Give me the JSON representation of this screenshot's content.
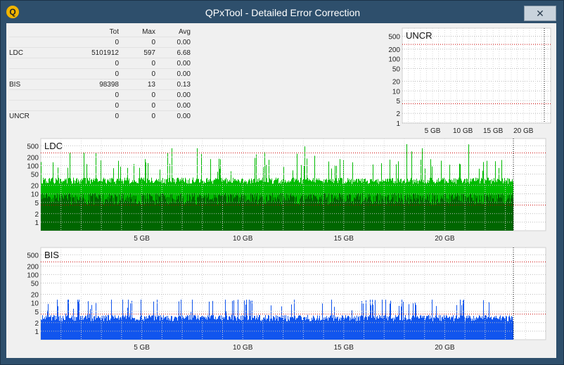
{
  "window": {
    "title": "QPxTool - Detailed Error Correction",
    "icon_letter": "Q",
    "close_glyph": "✕"
  },
  "stats": {
    "headers": [
      "",
      "Tot",
      "Max",
      "Avg"
    ],
    "rows": [
      {
        "label": "",
        "tot": "0",
        "max": "0",
        "avg": "0.00"
      },
      {
        "label": "LDC",
        "tot": "5101912",
        "max": "597",
        "avg": "6.68"
      },
      {
        "label": "",
        "tot": "0",
        "max": "0",
        "avg": "0.00"
      },
      {
        "label": "",
        "tot": "0",
        "max": "0",
        "avg": "0.00"
      },
      {
        "label": "BIS",
        "tot": "98398",
        "max": "13",
        "avg": "0.13"
      },
      {
        "label": "",
        "tot": "0",
        "max": "0",
        "avg": "0.00"
      },
      {
        "label": "",
        "tot": "0",
        "max": "0",
        "avg": "0.00"
      },
      {
        "label": "UNCR",
        "tot": "0",
        "max": "0",
        "avg": "0.00"
      }
    ]
  },
  "colors": {
    "ldc_light": "#00bb00",
    "ldc_dark": "#006600",
    "bis_light": "#1155ee",
    "bis_dark": "#001a66",
    "threshold": "#cc0000",
    "grid": "#bbbbbb"
  },
  "chart_data": [
    {
      "type": "area",
      "title": "UNCR",
      "y_ticks": [
        1,
        2,
        5,
        10,
        20,
        50,
        100,
        200,
        500
      ],
      "x_ticks": [
        "5 GB",
        "10 GB",
        "15 GB",
        "20 GB"
      ],
      "x_tick_values": [
        5,
        10,
        15,
        20
      ],
      "xlim": [
        0,
        24.5
      ],
      "ylim": [
        1,
        900
      ],
      "log_scale": true,
      "threshold_lines": [
        4,
        280
      ],
      "series": [
        {
          "values_max": 0
        }
      ]
    },
    {
      "type": "area",
      "title": "LDC",
      "y_ticks": [
        1,
        2,
        5,
        10,
        20,
        50,
        100,
        200,
        500
      ],
      "x_ticks": [
        "5 GB",
        "10 GB",
        "15 GB",
        "20 GB"
      ],
      "x_tick_values": [
        5,
        10,
        15,
        20
      ],
      "xlim": [
        0,
        25
      ],
      "ylim": [
        0.5,
        900
      ],
      "log_scale": true,
      "threshold_lines": [
        4,
        280
      ],
      "end_gb": 23.4,
      "series": [
        {
          "name_hidden": "max",
          "base": 30,
          "spike_peak": 597
        },
        {
          "name_hidden": "avg",
          "value": 6.68
        }
      ]
    },
    {
      "type": "area",
      "title": "BIS",
      "y_ticks": [
        1,
        2,
        5,
        10,
        20,
        50,
        100,
        200,
        500
      ],
      "x_ticks": [
        "5 GB",
        "10 GB",
        "15 GB",
        "20 GB"
      ],
      "x_tick_values": [
        5,
        10,
        15,
        20
      ],
      "xlim": [
        0,
        25
      ],
      "ylim": [
        0.5,
        900
      ],
      "log_scale": true,
      "threshold_lines": [
        4,
        280
      ],
      "end_gb": 23.4,
      "series": [
        {
          "name_hidden": "max",
          "base": 3,
          "spike_peak": 13
        },
        {
          "name_hidden": "avg",
          "value": 0.13
        }
      ]
    }
  ]
}
